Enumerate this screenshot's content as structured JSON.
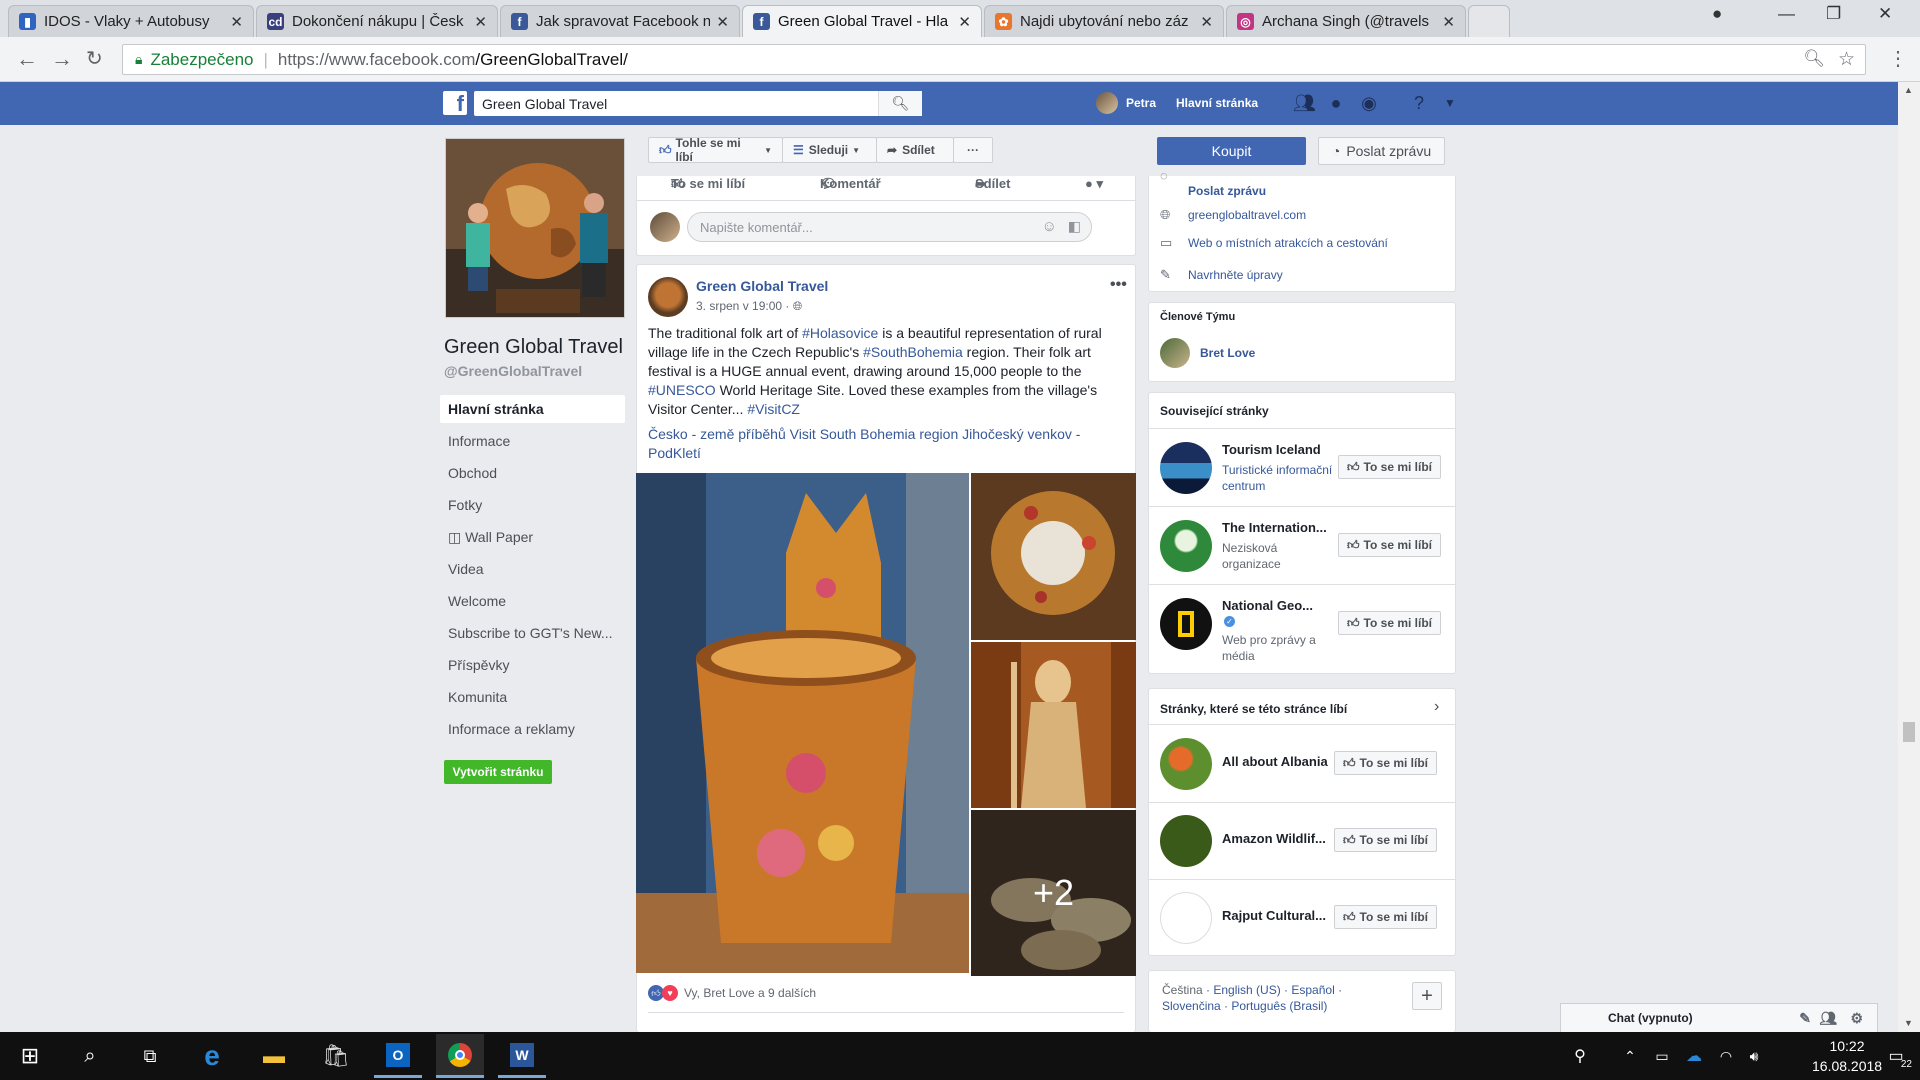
{
  "browser": {
    "tabs": [
      {
        "title": "IDOS - Vlaky + Autobusy",
        "icon_color": "#2f64c0"
      },
      {
        "title": "Dokončení nákupu | Česk",
        "icon_color": "#3a3f7e"
      },
      {
        "title": "Jak spravovat Facebook n",
        "icon_color": "#3b5998"
      },
      {
        "title": "Green Global Travel - Hla",
        "icon_color": "#3b5998"
      },
      {
        "title": "Najdi ubytování nebo záz",
        "icon_color": "#e8762c"
      },
      {
        "title": "Archana Singh (@travels",
        "icon_color": "#c13584"
      }
    ],
    "secure_label": "Zabezpečeno",
    "url_prefix": "https://www.facebook.com",
    "url_path": "/GreenGlobalTravel/"
  },
  "fb_header": {
    "search_value": "Green Global Travel",
    "user": "Petra",
    "home": "Hlavní stránka"
  },
  "page": {
    "name": "Green Global Travel",
    "handle": "@GreenGlobalTravel",
    "nav": [
      "Hlavní stránka",
      "Informace",
      "Obchod",
      "Fotky",
      "◫ Wall Paper",
      "Videa",
      "Welcome",
      "Subscribe to GGT's New...",
      "Příspěvky",
      "Komunita",
      "Informace a reklamy"
    ],
    "create_page": "Vytvořit stránku"
  },
  "actions": {
    "like": "Tohle se mi líbí",
    "follow": "Sleduji",
    "share": "Sdílet",
    "more": "···",
    "buy": "Koupit",
    "message": "Poslat zprávu"
  },
  "prev_post": {
    "like": "To se mi líbí",
    "comment": "Komentář",
    "share": "Sdílet",
    "comment_placeholder": "Napište komentář..."
  },
  "post": {
    "author": "Green Global Travel",
    "date": "3. srpen v 19:00 ·",
    "text_parts": [
      {
        "t": "The traditional folk art of ",
        "h": false
      },
      {
        "t": "#Holasovice",
        "h": true
      },
      {
        "t": " is a beautiful representation of rural village life in the Czech Republic's ",
        "h": false
      },
      {
        "t": "#SouthBohemia",
        "h": true
      },
      {
        "t": " region. Their folk art festival is a HUGE annual event, drawing around 15,000 people to the ",
        "h": false
      },
      {
        "t": "#UNESCO",
        "h": true
      },
      {
        "t": " World Heritage Site. Loved these examples from the village's Visitor Center... ",
        "h": false
      },
      {
        "t": "#VisitCZ",
        "h": true
      }
    ],
    "tags": "Česko - země příběhů Visit South Bohemia region Jihočeský venkov - PodKletí",
    "more_photos": "+2",
    "reactions": "Vy, Bret Love a 9 dalších"
  },
  "right": {
    "info_top": "Poslat zprávu",
    "website": "greenglobaltravel.com",
    "category": "Web o místních atrakcích a cestování",
    "suggest": "Navrhněte úpravy",
    "team_head": "Členové Týmu",
    "team_member": "Bret Love",
    "related_head": "Související stránky",
    "related": [
      {
        "name": "Tourism Iceland",
        "sub": "Turistické informační centrum",
        "btn": "To se mi líbí"
      },
      {
        "name": "The Internation...",
        "sub": "Nezisková organizace",
        "btn": "To se mi líbí"
      },
      {
        "name": "National Geo...",
        "sub": "Web pro zprávy a média",
        "btn": "To se mi líbí"
      }
    ],
    "liked_head": "Stránky, které se této stránce líbí",
    "liked": [
      {
        "name": "All about Albania",
        "btn": "To se mi líbí"
      },
      {
        "name": "Amazon Wildlif...",
        "btn": "To se mi líbí"
      },
      {
        "name": "Rajput Cultural...",
        "btn": "To se mi líbí"
      }
    ],
    "languages_current": "Čeština",
    "languages_line1": " · English (US) · Español ·",
    "languages_line2": "Slovenčina · Português (Brasil)",
    "chat": "Chat (vypnuto)"
  },
  "taskbar": {
    "time": "10:22",
    "date": "16.08.2018",
    "notifications": "22"
  }
}
